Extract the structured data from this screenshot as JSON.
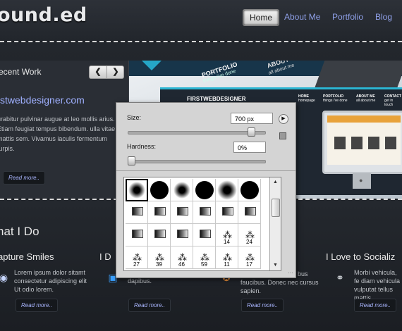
{
  "site": {
    "logo": "ound.ed",
    "nav": [
      {
        "label": "Home"
      },
      {
        "label": "About Me"
      },
      {
        "label": "Portfolio"
      },
      {
        "label": "Blog"
      }
    ],
    "recent": {
      "title": "ecent Work",
      "prev_icon": "chevron-left-icon",
      "next_icon": "chevron-right-icon",
      "link": "stwebdesigner.com",
      "text": "urabitur pulvinar augue at leo mollis arius. Etiam feugiat tempus bibendum. ulla vitae mattis sem. Vivamus iaculis fermentum turpis.",
      "readmore": "Read more.."
    },
    "slide": {
      "portfolio": "PORTFOLIO",
      "portfolio_sub": "things i've done",
      "about": "ABOUT",
      "about_sub": "all about me",
      "brand": "FIRSTWEBDESIGNER",
      "nav": [
        "HOME",
        "PORTFOLIO",
        "ABOUT ME",
        "CONTACT"
      ],
      "nav_sub": [
        "homepage",
        "things i've done",
        "all about me",
        "get in touch"
      ],
      "monitor_logo": ""
    },
    "what_i_do": {
      "title": "hat I Do",
      "columns": [
        {
          "title": "apture Smiles",
          "icon": "camera-icon",
          "text": "Lorem ipsum dolor sitamt consectetur adipiscing elit Ut odio lorem.",
          "readmore": "Read more.."
        },
        {
          "title": "I D",
          "icon": "monitor-icon",
          "text": "Quisque elementum arcu ut dapibus.",
          "readmore": "Read more.."
        },
        {
          "title": "",
          "icon": "award-icon",
          "text": "faucibus. Donec nec cursus sapien.",
          "text_prefix": "bus",
          "readmore": "Read more.."
        },
        {
          "title": "I Love to Socializ",
          "icon": "link-icon",
          "text": "Morbi vehicula, fe diam vehicula vulputat tellus mattis.",
          "readmore": "Read more.."
        }
      ]
    }
  },
  "brush_picker": {
    "size_label": "Size:",
    "size_value": "700 px",
    "size_level": 0.92,
    "hardness_label": "Hardness:",
    "hardness_value": "0%",
    "hardness_level": 0.0,
    "menu_icon": "play-menu-icon",
    "new_preset_icon": "new-preset-icon",
    "brushes": [
      {
        "type": "soft",
        "size": 18,
        "label": "",
        "selected": true
      },
      {
        "type": "hard",
        "size": 26,
        "label": ""
      },
      {
        "type": "soft",
        "size": 18,
        "label": ""
      },
      {
        "type": "hard",
        "size": 26,
        "label": ""
      },
      {
        "type": "soft",
        "size": 22,
        "label": ""
      },
      {
        "type": "hard",
        "size": 26,
        "label": ""
      },
      {
        "type": "shape",
        "label": ""
      },
      {
        "type": "shape",
        "label": ""
      },
      {
        "type": "shape",
        "label": ""
      },
      {
        "type": "shape",
        "label": ""
      },
      {
        "type": "shape",
        "label": ""
      },
      {
        "type": "shape",
        "label": ""
      },
      {
        "type": "shape",
        "label": ""
      },
      {
        "type": "shape",
        "label": ""
      },
      {
        "type": "shape",
        "label": ""
      },
      {
        "type": "shape",
        "label": ""
      },
      {
        "type": "splat",
        "label": "14"
      },
      {
        "type": "splat",
        "label": "24"
      },
      {
        "type": "splat",
        "label": "27"
      },
      {
        "type": "splat",
        "label": "39"
      },
      {
        "type": "splat",
        "label": "46"
      },
      {
        "type": "splat",
        "label": "59"
      },
      {
        "type": "splat",
        "label": "11"
      },
      {
        "type": "splat",
        "label": "17"
      }
    ]
  }
}
